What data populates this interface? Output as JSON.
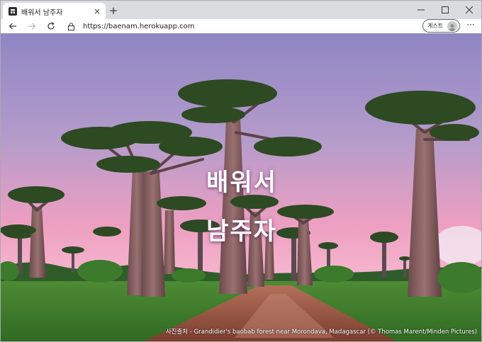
{
  "browser": {
    "tab_title": "배워서 남주자",
    "url": "https://baenam.herokuapp.com",
    "profile_label": "게스트",
    "new_tab_symbol": "+",
    "close_tab_symbol": "×",
    "more_symbol": "···"
  },
  "page": {
    "hero_line1": "배워서",
    "hero_line2": "남주자",
    "photo_credit": "사진출처 - Grandidier's baobab forest near Morondava, Madagascar (© Thomas Marent/Minden Pictures)"
  },
  "colors": {
    "sky_top": "#9c8fc8",
    "sky_bottom": "#f2a9c4",
    "grass": "#3f7d2c",
    "road": "#8a4a38"
  }
}
